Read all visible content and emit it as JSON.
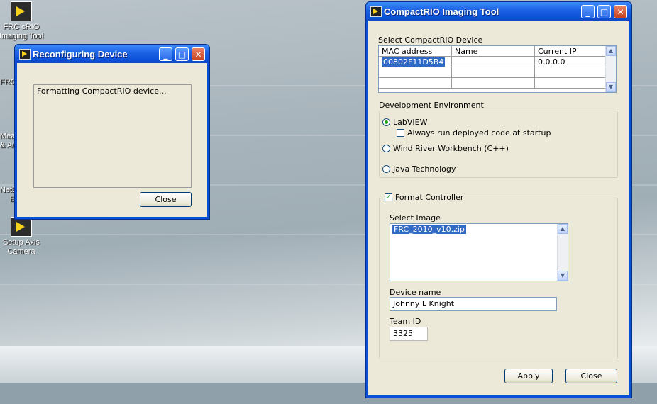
{
  "desktop": {
    "icons": [
      {
        "label_line1": "FRC cRIO",
        "label_line2": "Imaging Tool"
      },
      {
        "label_line1": "Setup Axis",
        "label_line2": "Camera"
      }
    ],
    "partial_labels": [
      "FRC",
      "Meas",
      "& Au",
      "NetB",
      "E"
    ]
  },
  "reconfig_window": {
    "title": "Reconfiguring Device",
    "status_text": "Formatting CompactRIO device...",
    "close_label": "Close"
  },
  "imaging_window": {
    "title": "CompactRIO Imaging Tool",
    "select_device_label": "Select CompactRIO Device",
    "columns": [
      "MAC address",
      "Name",
      "Current IP"
    ],
    "rows": [
      {
        "mac": "00802F11D5B4",
        "name": "",
        "ip": "0.0.0.0"
      },
      {
        "mac": "",
        "name": "",
        "ip": ""
      },
      {
        "mac": "",
        "name": "",
        "ip": ""
      }
    ],
    "dev_env_label": "Development Environment",
    "env_options": [
      {
        "label": "LabVIEW",
        "checked": true
      },
      {
        "label": "Wind River Workbench (C++)",
        "checked": false
      },
      {
        "label": "Java Technology",
        "checked": false
      }
    ],
    "always_run_label": "Always run deployed code at startup",
    "always_run_checked": false,
    "format_controller_label": "Format Controller",
    "format_controller_checked": true,
    "select_image_label": "Select Image",
    "image_selected": "FRC_2010_v10.zip",
    "device_name_label": "Device name",
    "device_name_value": "Johnny L Knight",
    "team_id_label": "Team ID",
    "team_id_value": "3325",
    "apply_label": "Apply",
    "close_label": "Close"
  }
}
